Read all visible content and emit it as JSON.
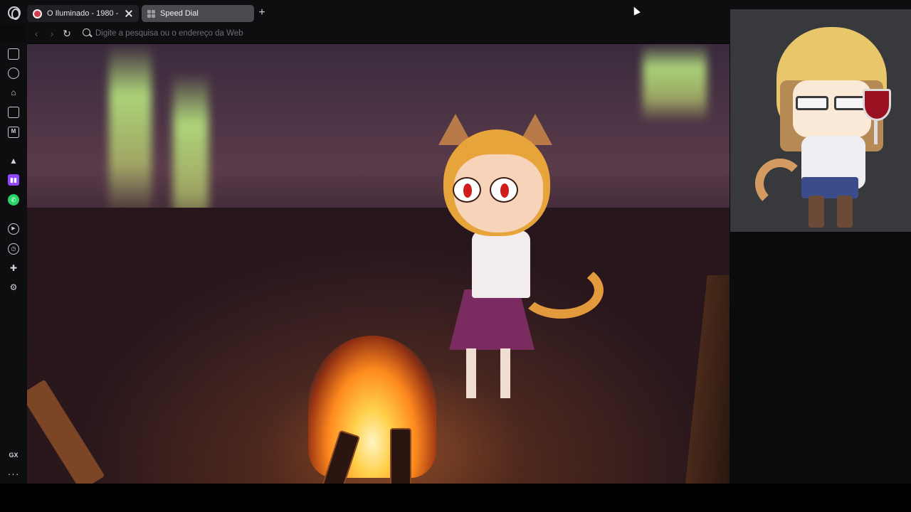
{
  "tabs": [
    {
      "title": "O Iluminado - 1980 -",
      "active": true
    },
    {
      "title": "Speed Dial",
      "active": false
    }
  ],
  "address_bar": {
    "placeholder": "Digite a pesquisa ou o endereço da Web"
  },
  "sidebar": {
    "items": [
      {
        "icon": "gaming-controller-icon"
      },
      {
        "icon": "speedometer-icon"
      },
      {
        "icon": "cleaner-icon"
      },
      {
        "icon": "gx-corner-icon"
      },
      {
        "icon": "music-player-icon",
        "glyph": "M"
      },
      {
        "icon": "aria-icon"
      },
      {
        "icon": "twitch-icon"
      },
      {
        "icon": "whatsapp-icon"
      },
      {
        "icon": "player-icon"
      },
      {
        "icon": "history-icon"
      },
      {
        "icon": "extensions-icon"
      },
      {
        "icon": "settings-icon"
      }
    ],
    "gx_label": "GX",
    "more_label": "···"
  },
  "colors": {
    "tab_active_bg": "#1f1f24",
    "tab_inactive_bg": "#4a4a50",
    "twitch_purple": "#9146ff",
    "whatsapp_green": "#25d366",
    "chrome_bg": "#0e0e11"
  }
}
